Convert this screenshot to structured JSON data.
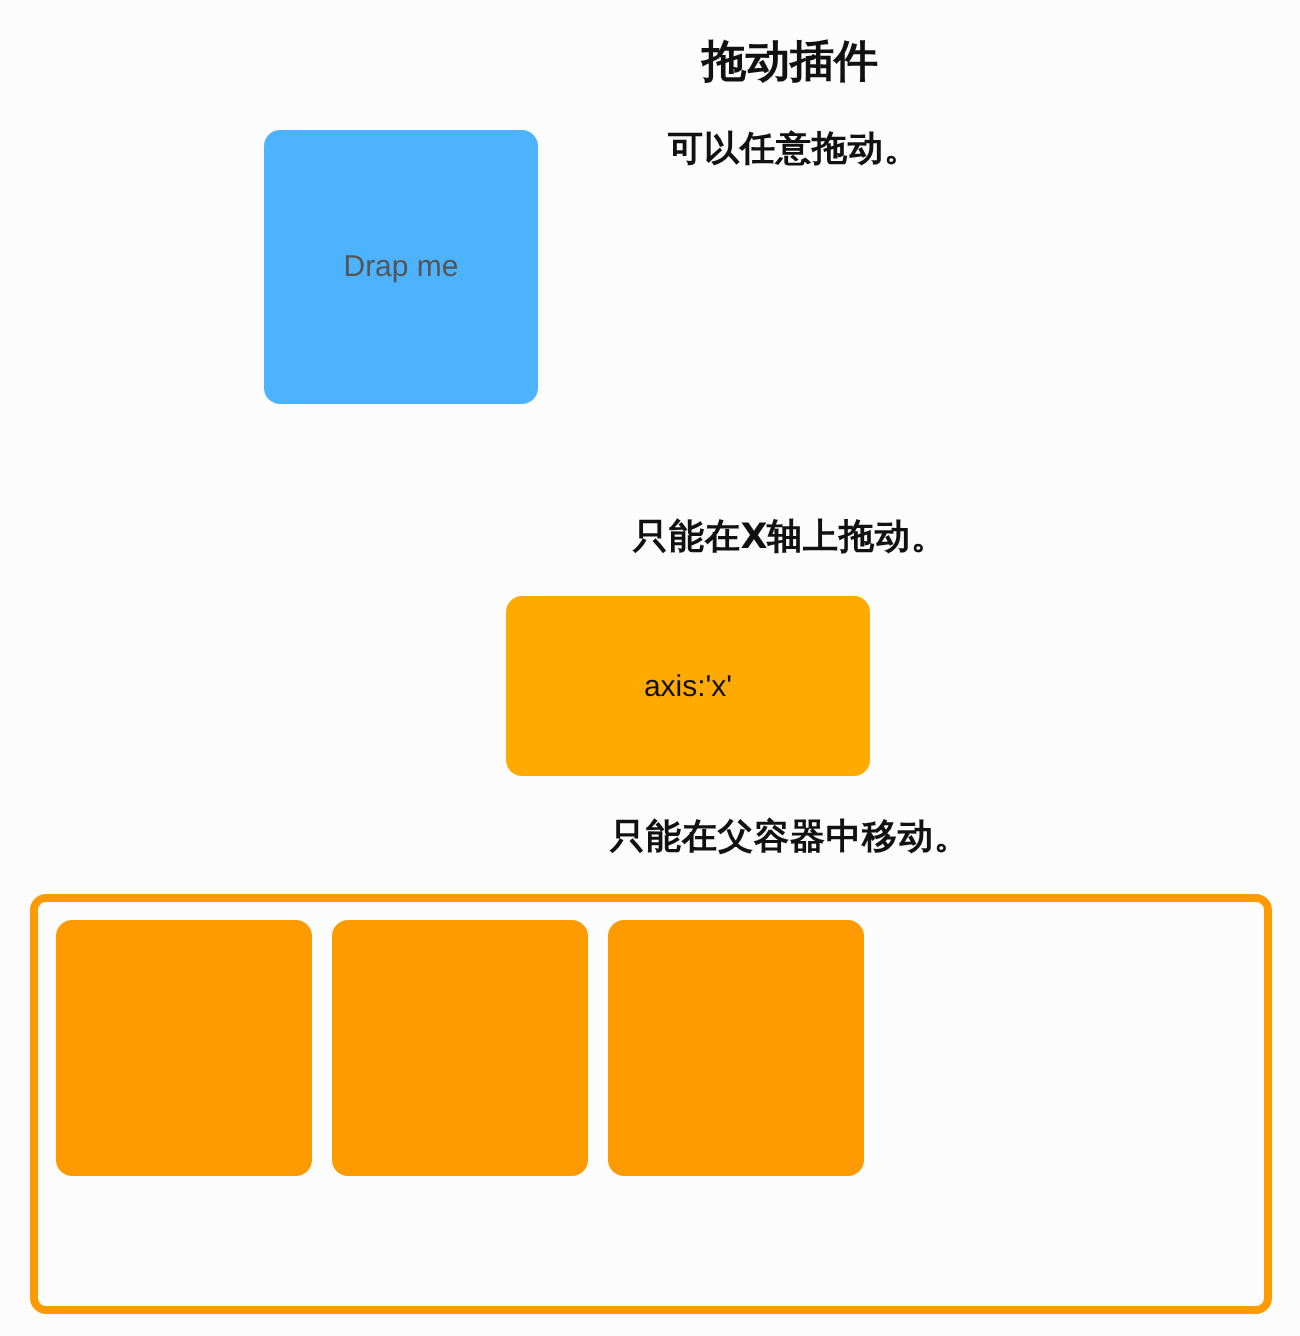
{
  "title": "拖动插件",
  "free_drag": {
    "caption": "可以任意拖动。",
    "box_label": "Drap me"
  },
  "axis_drag": {
    "caption": "只能在X轴上拖动。",
    "box_label": "axis:'x'"
  },
  "parent_drag": {
    "caption": "只能在父容器中移动。",
    "blocks": [
      {
        "kind": "block"
      },
      {
        "kind": "block"
      },
      {
        "kind": "block"
      }
    ]
  }
}
